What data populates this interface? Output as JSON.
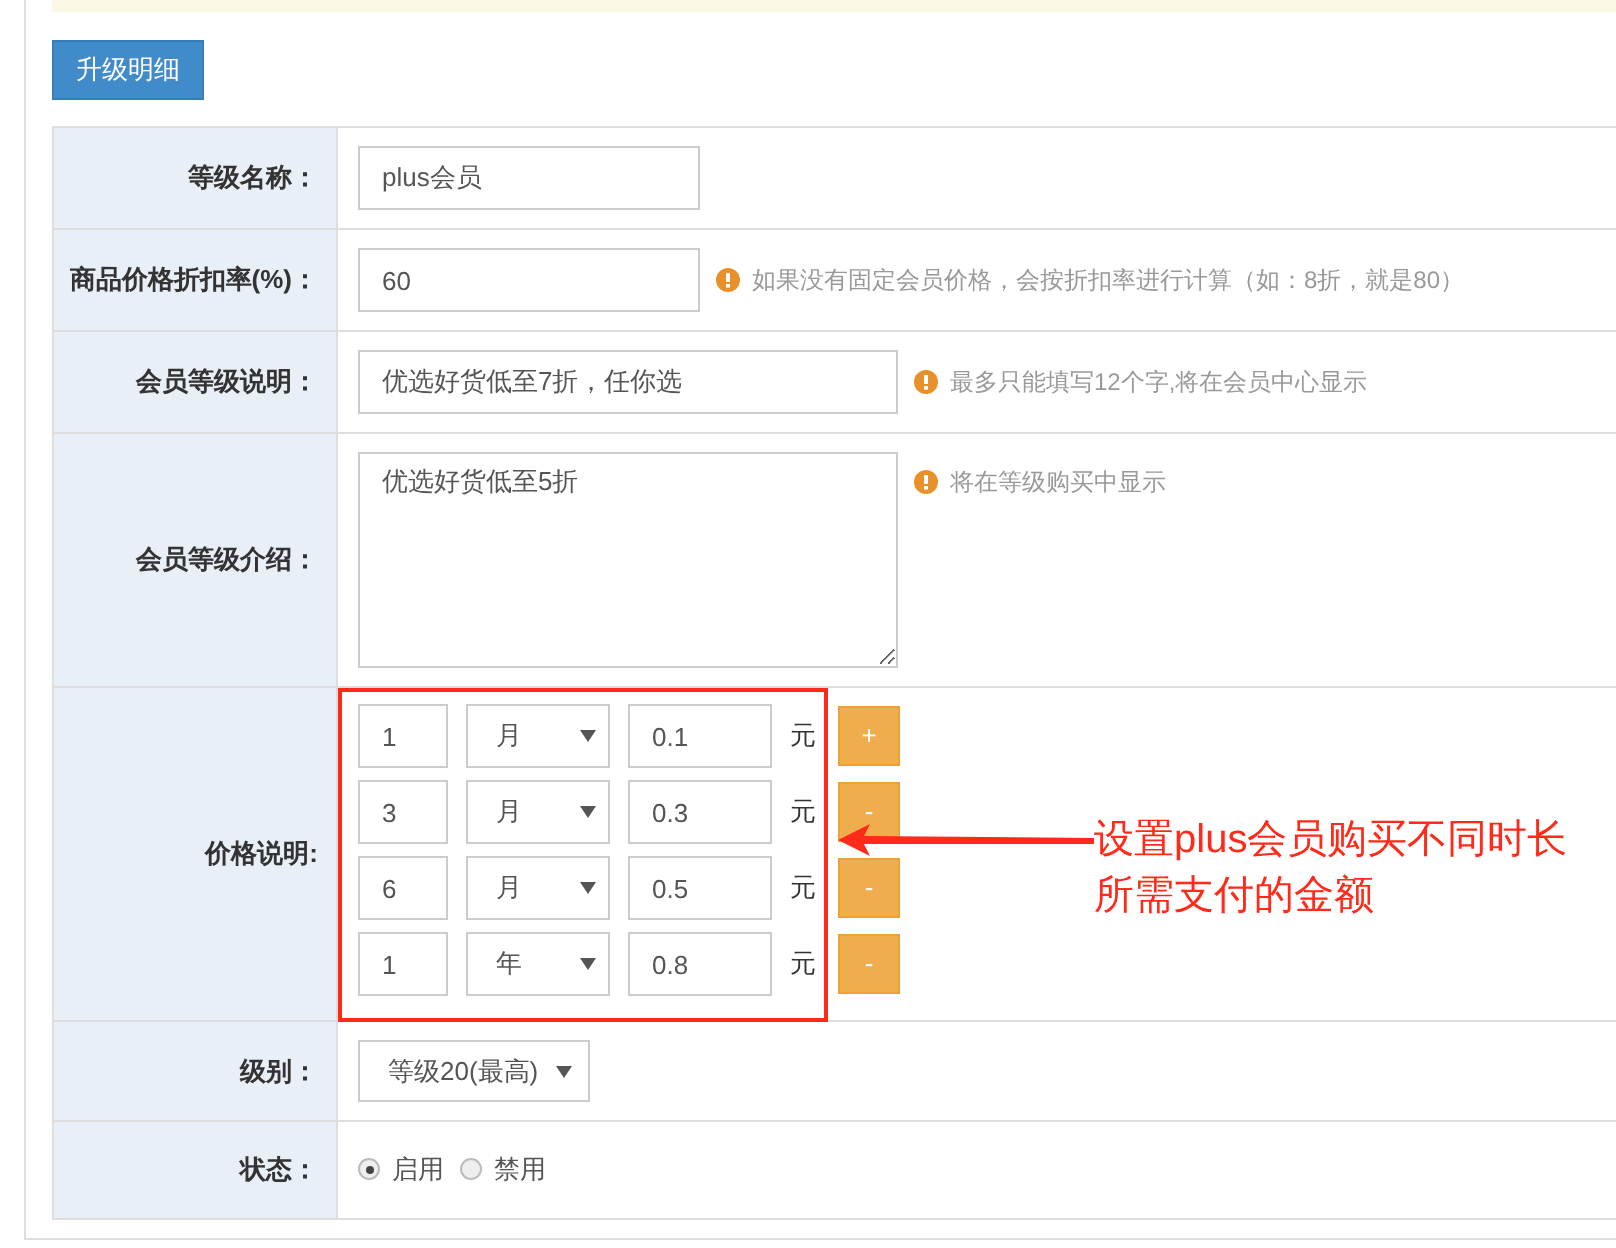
{
  "top_button": "升级明细",
  "fields": [
    {
      "kind": "text",
      "label": "等级名称：",
      "value": "plus会员"
    },
    {
      "kind": "text",
      "label": "商品价格折扣率(%)：",
      "value": "60",
      "hint": "如果没有固定会员价格，会按折扣率进行计算（如：8折，就是80）"
    },
    {
      "kind": "text",
      "label": "会员等级说明：",
      "value": "优选好货低至7折，任你选",
      "wide": true,
      "hint": "最多只能填写12个字,将在会员中心显示"
    },
    {
      "kind": "textarea",
      "label": "会员等级介绍：",
      "value": "优选好货低至5折",
      "hint": "将在等级购买中显示"
    },
    {
      "kind": "prices",
      "label": "价格说明:",
      "rows": [
        {
          "count": "1",
          "unit": "月",
          "amount": "0.1",
          "currency": "元",
          "button": "+"
        },
        {
          "count": "3",
          "unit": "月",
          "amount": "0.3",
          "currency": "元",
          "button": "-"
        },
        {
          "count": "6",
          "unit": "月",
          "amount": "0.5",
          "currency": "元",
          "button": "-"
        },
        {
          "count": "1",
          "unit": "年",
          "amount": "0.8",
          "currency": "元",
          "button": "-"
        }
      ]
    },
    {
      "kind": "select",
      "label": "级别：",
      "value": "等级20(最高)"
    },
    {
      "kind": "radio",
      "label": "状态：",
      "options": [
        {
          "label": "启用",
          "selected": true
        },
        {
          "label": "禁用",
          "selected": false
        }
      ]
    }
  ],
  "annotation": {
    "lines": [
      "设置plus会员购买不同时长",
      "所需支付的金额"
    ]
  }
}
